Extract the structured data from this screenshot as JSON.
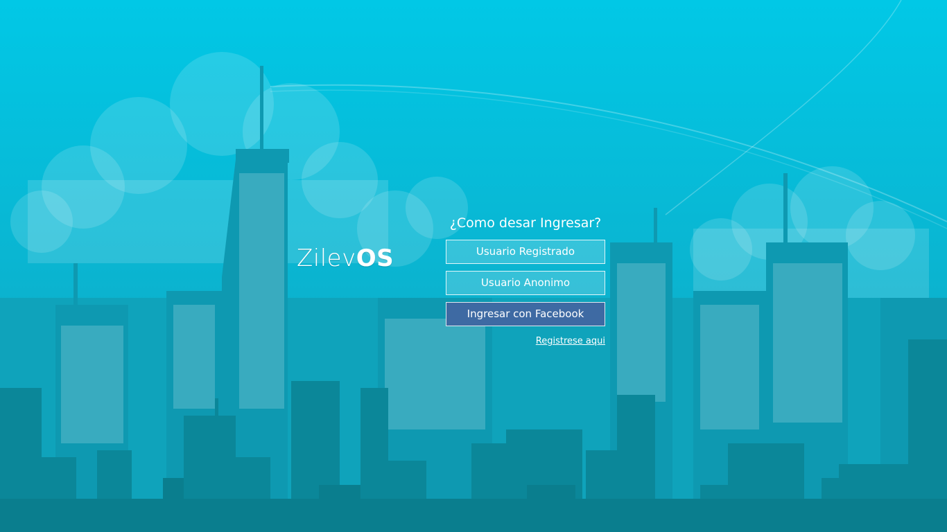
{
  "brand": {
    "name_light": "Zilev",
    "name_bold": "OS"
  },
  "login": {
    "question": "¿Como desar Ingresar?",
    "registered_user_label": "Usuario Registrado",
    "anonymous_user_label": "Usuario Anonimo",
    "facebook_label": "Ingresar con Facebook",
    "register_link": "Registrese aqui"
  },
  "colors": {
    "sky_top": "#01c8e6",
    "sky_bottom": "#0a9db6",
    "facebook_button": "#3e6aa3",
    "text": "#ffffff"
  }
}
